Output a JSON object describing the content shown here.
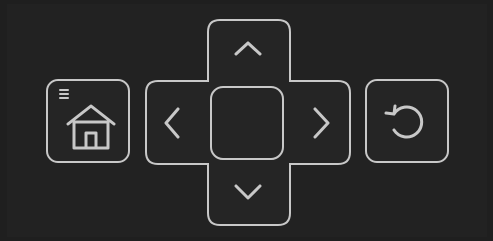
{
  "remote": {
    "home_button": {
      "icon": "home-icon",
      "badge_icon": "menu-icon"
    },
    "dpad": {
      "up_icon": "chevron-up-icon",
      "down_icon": "chevron-down-icon",
      "left_icon": "chevron-left-icon",
      "right_icon": "chevron-right-icon",
      "center": "ok-button"
    },
    "back_button": {
      "icon": "refresh-icon"
    }
  },
  "colors": {
    "background": "#222222",
    "stroke": "#c8c8c8"
  }
}
